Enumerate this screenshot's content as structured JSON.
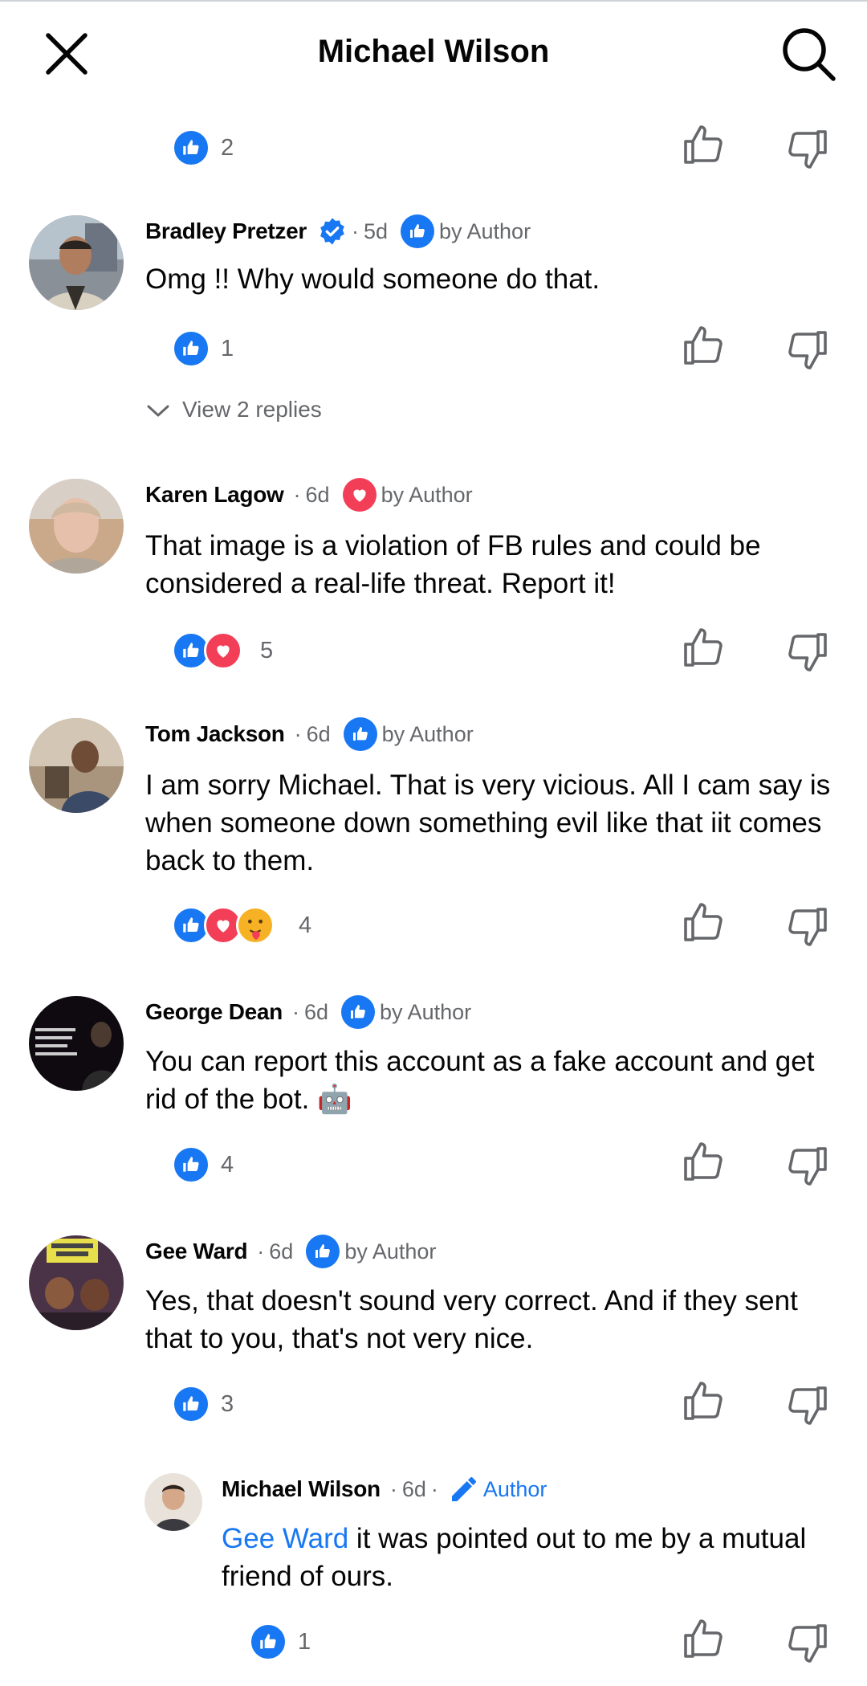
{
  "header": {
    "title": "Michael Wilson"
  },
  "top_reactions": {
    "count": "2"
  },
  "comments": [
    {
      "name": "Bradley Pretzer",
      "verified": true,
      "time": "5d",
      "author_reaction": "like",
      "by_author": "by Author",
      "text": "Omg !! Why would someone do that.",
      "reaction_count": "1",
      "view_replies": "View 2 replies"
    },
    {
      "name": "Karen Lagow",
      "time": "6d",
      "author_reaction": "love",
      "by_author": "by Author",
      "text": "That image is a violation of FB rules and could be considered a real-life threat. Report it!",
      "reaction_count": "5"
    },
    {
      "name": "Tom Jackson",
      "time": "6d",
      "author_reaction": "like",
      "by_author": "by Author",
      "text": "I am sorry Michael.  That is very vicious.  All I cam say is when someone down something evil like that iit comes back to them.",
      "reaction_count": "4"
    },
    {
      "name": "George Dean",
      "time": "6d",
      "author_reaction": "like",
      "by_author": "by Author",
      "text": "You can report this account as a fake account and get rid of the bot. 🤖",
      "reaction_count": "4"
    },
    {
      "name": "Gee Ward",
      "time": "6d",
      "author_reaction": "like",
      "by_author": "by Author",
      "text": "Yes, that doesn't sound very correct. And if they sent that to you, that's not very nice.",
      "reaction_count": "3"
    }
  ],
  "reply": {
    "name": "Michael Wilson",
    "time": "6d",
    "author_label": "Author",
    "mention": "Gee Ward",
    "text": " it was pointed out to me by a mutual friend of ours.",
    "reaction_count": "1"
  },
  "colors": {
    "facebook_blue": "#1877f2",
    "love_red": "#f33e58",
    "meta_gray": "#65676b"
  }
}
